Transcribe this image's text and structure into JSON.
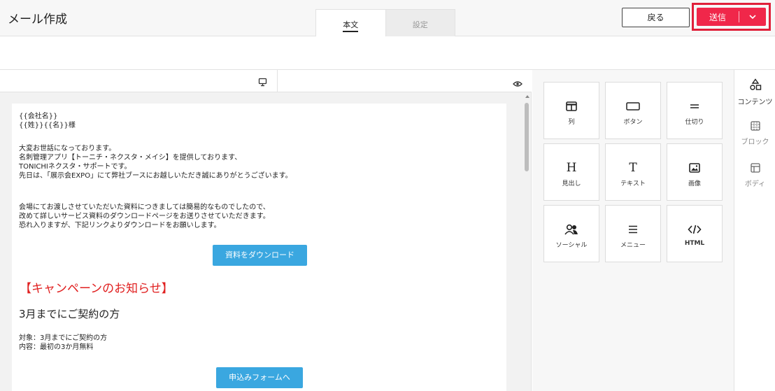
{
  "header": {
    "title": "メール作成",
    "tabs": [
      {
        "label": "本文"
      },
      {
        "label": "設定"
      }
    ],
    "back_label": "戻る",
    "send_label": "送信"
  },
  "email": {
    "greeting": [
      "{{会社名}}",
      "{{姓}}{{名}}様"
    ],
    "intro": [
      "大変お世話になっております。",
      "名刺管理アプリ【トーニチ・ネクスタ・メイシ】を提供しております、",
      "TONICHIネクスタ・サポートです。",
      "先日は、「展示会EXPO」にて弊社ブースにお越しいただき誠にありがとうございます。"
    ],
    "body": [
      "会場にてお渡しさせていただいた資料につきましては簡易的なものでしたので、",
      "改めて詳しいサービス資料のダウンロードページをお送りさせていただきます。",
      "恐れ入りますが、下記リンクよりダウンロードをお願いします。"
    ],
    "download_button": "資料をダウンロード",
    "campaign_heading": "【キャンペーンのお知らせ】",
    "sub_heading": "3月までにご契約の方",
    "details": [
      "対象：3月までにご契約の方",
      "内容：最初の3か月無料"
    ],
    "form_button": "申込みフォームへ"
  },
  "content_blocks": [
    {
      "label": "列",
      "icon": "columns-icon"
    },
    {
      "label": "ボタン",
      "icon": "button-icon"
    },
    {
      "label": "仕切り",
      "icon": "divider-icon"
    },
    {
      "label": "見出し",
      "icon": "heading-icon"
    },
    {
      "label": "テキスト",
      "icon": "text-icon"
    },
    {
      "label": "画像",
      "icon": "image-icon"
    },
    {
      "label": "ソーシャル",
      "icon": "social-icon"
    },
    {
      "label": "メニュー",
      "icon": "menu-icon"
    },
    {
      "label": "HTML",
      "icon": "html-icon"
    }
  ],
  "sidebar": {
    "items": [
      {
        "label": "コンテンツ",
        "icon": "shapes-icon"
      },
      {
        "label": "ブロック",
        "icon": "blocks-icon"
      },
      {
        "label": "ボディ",
        "icon": "body-layout-icon"
      }
    ]
  },
  "colors": {
    "send": "#f0274a",
    "highlight": "#e0203a",
    "cta": "#3aa7e0",
    "campaign": "#e02020"
  }
}
